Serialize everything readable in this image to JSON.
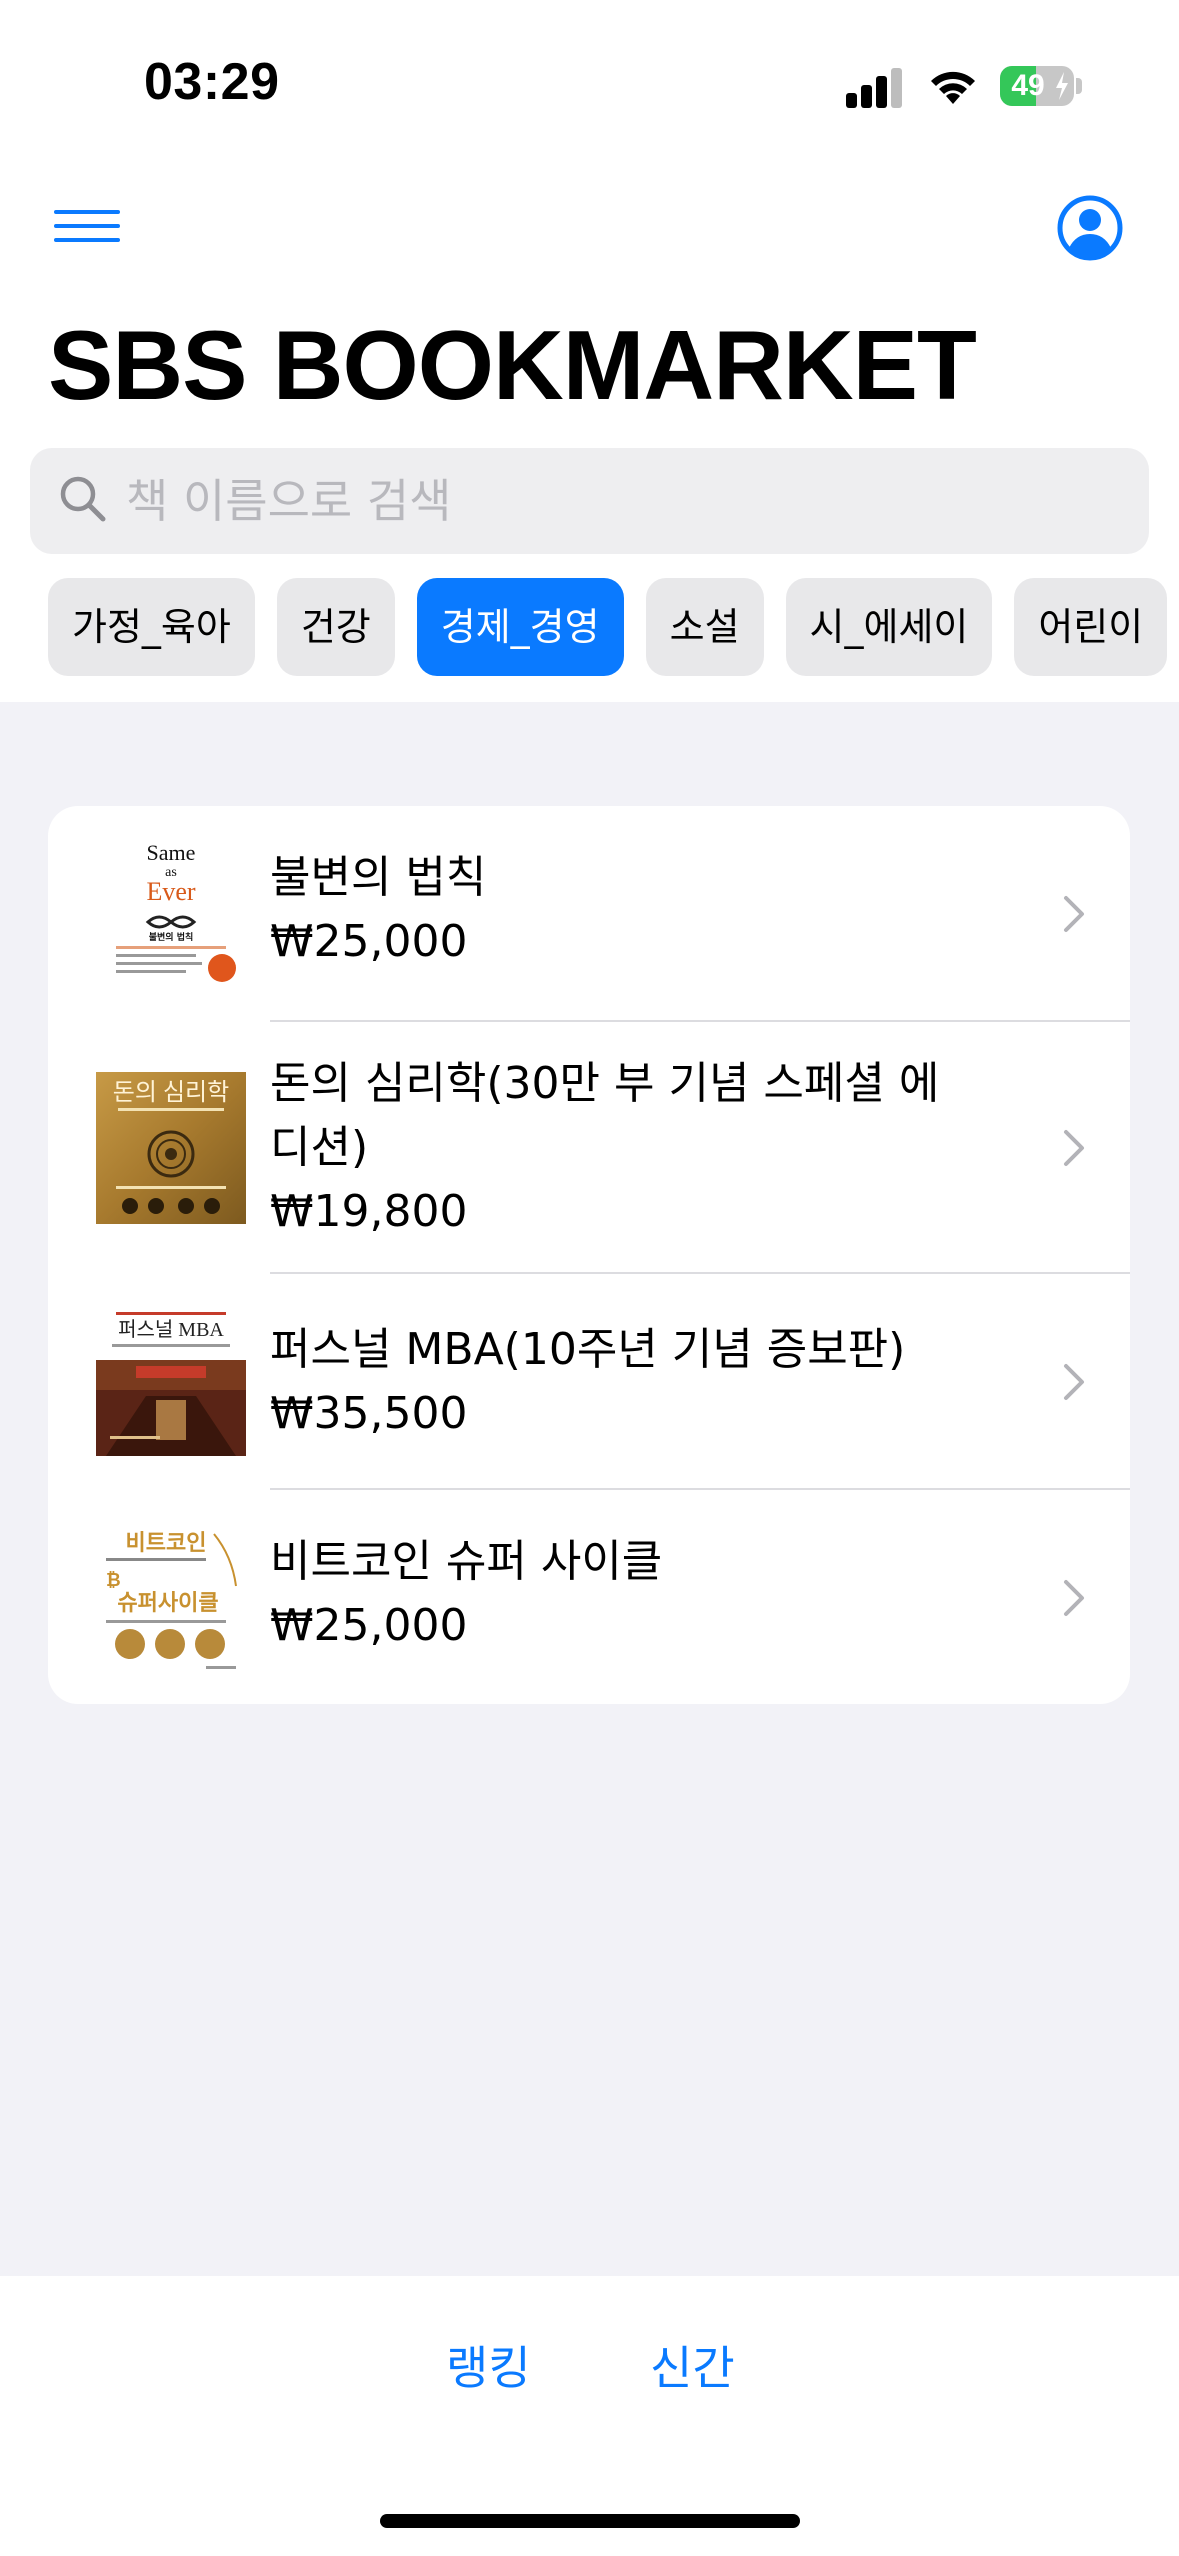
{
  "status_bar": {
    "time": "03:29",
    "battery_percent": "49",
    "battery_level": 0.49
  },
  "header": {
    "menu_icon": "hamburger-menu-icon",
    "profile_icon": "person-circle-icon",
    "title": "SBS BOOKMARKET"
  },
  "search": {
    "placeholder": "책 이름으로 검색",
    "value": ""
  },
  "categories": {
    "items": [
      "가정_육아",
      "건강",
      "경제_경영",
      "소설",
      "시_에세이",
      "어린이"
    ],
    "selected": "경제_경영"
  },
  "books": [
    {
      "title": "불변의 법칙",
      "price": "₩25,000",
      "cover": {
        "line1": "Same",
        "line2": "as",
        "line3": "Ever",
        "subtitle": "불변의 법칙"
      }
    },
    {
      "title": "돈의 심리학(30만 부 기념 스페셜 에디션)",
      "price": "₩19,800",
      "cover": {
        "line1": "돈의 심리학"
      }
    },
    {
      "title": "퍼스널 MBA(10주년 기념 증보판)",
      "price": "₩35,500",
      "cover": {
        "line1": "퍼스널 MBA"
      }
    },
    {
      "title": "비트코인 슈퍼 사이클",
      "price": "₩25,000",
      "cover": {
        "line1": "비트코인",
        "line2": "슈퍼사이클"
      }
    }
  ],
  "tab_bar": {
    "tabs": [
      "랭킹",
      "신간"
    ]
  },
  "colors": {
    "accent": "#0a7aff",
    "background_grouped": "#f2f2f7",
    "chip_bg": "#e8e8ea",
    "battery_green": "#34c759"
  }
}
